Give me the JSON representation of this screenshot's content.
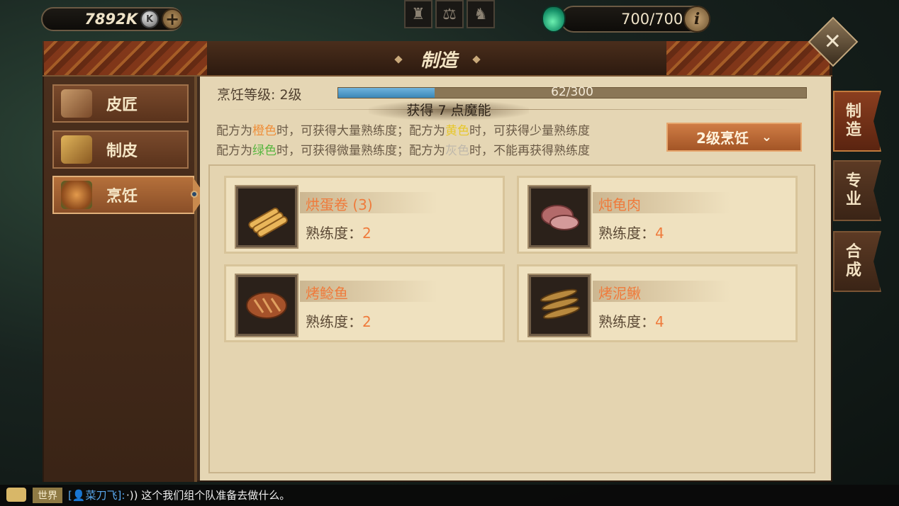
{
  "hud": {
    "currency_value": "7892K",
    "currency_icon": "K",
    "energy_value": "700/700"
  },
  "panel": {
    "title": "制造"
  },
  "sidebar": {
    "items": [
      {
        "label": "皮匠",
        "icon": "scroll-tools-icon"
      },
      {
        "label": "制皮",
        "icon": "leather-icon"
      },
      {
        "label": "烹饪",
        "icon": "roast-chicken-icon",
        "active": true
      }
    ]
  },
  "cooking": {
    "level_label": "烹饪等级: 2级",
    "progress_text": "62/300",
    "progress_fraction": 0.2067,
    "gain_text": "获得 7 点魔能",
    "hint1": {
      "p1": "配方为",
      "c1": "橙色",
      "p2": "时，可获得大量熟练度；配方为",
      "c2": "黄色",
      "p3": "时，可获得少量熟练度"
    },
    "hint2": {
      "p1": "配方为",
      "c1": "绿色",
      "p2": "时，可获得微量熟练度；配方为",
      "c2": "灰色",
      "p3": "时，不能再获得熟练度"
    },
    "dropdown_label": "2级烹饪"
  },
  "recipes": [
    {
      "name": "烘蛋卷 (3)",
      "prof_label": "熟练度：",
      "prof_value": "2",
      "icon": "egg-roll-icon"
    },
    {
      "name": "炖龟肉",
      "prof_label": "熟练度：",
      "prof_value": "4",
      "icon": "turtle-meat-icon"
    },
    {
      "name": "烤鲶鱼",
      "prof_label": "熟练度：",
      "prof_value": "2",
      "icon": "grilled-catfish-icon"
    },
    {
      "name": "烤泥鳅",
      "prof_label": "熟练度：",
      "prof_value": "4",
      "icon": "grilled-loach-icon"
    }
  ],
  "right_tabs": [
    {
      "label": "制造",
      "active": true
    },
    {
      "label": "专业",
      "active": false
    },
    {
      "label": "合成",
      "active": false
    }
  ],
  "chat": {
    "channel": "世界",
    "user": "[👤菜刀飞]:",
    "message": "·)) 这个我们组个队准备去做什么。"
  },
  "colors": {
    "accent_orange": "#ef7b3c",
    "progress_blue": "#3a86b6",
    "parchment": "#e5d6b4"
  }
}
